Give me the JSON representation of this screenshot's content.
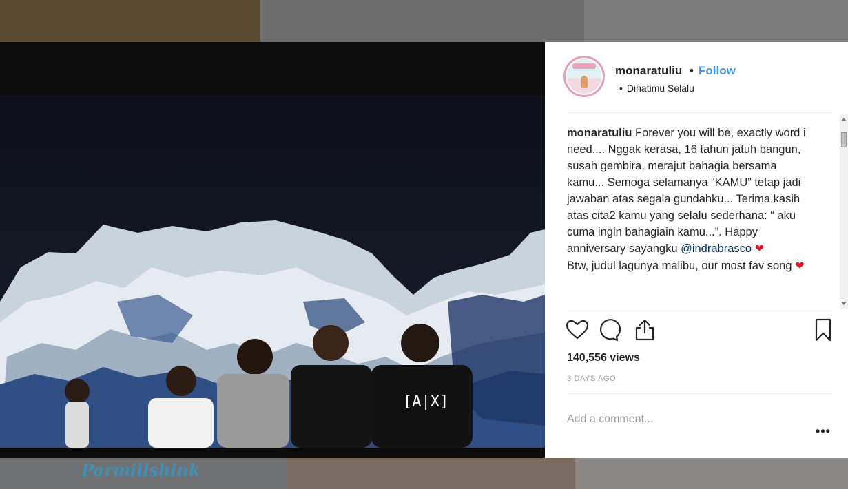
{
  "background": {
    "brand_text": "Parmillshink"
  },
  "post": {
    "username": "monaratuliu",
    "follow_label": "Follow",
    "separator": "•",
    "location": "Dihatimu Selalu",
    "caption": {
      "user": "monaratuliu",
      "text_1": " Forever you will be, exactly word i need.... Nggak kerasa, 16 tahun jatuh bangun, susah gembira, merajut bahagia bersama kamu... Semoga selamanya “KAMU” tetap jadi jawaban atas segala gundahku... Terima kasih atas cita2 kamu yang selalu sederhana: “ aku cuma ingin bahagiain kamu...”. Happy anniversary sayangku ",
      "mention": "@indrabrasco",
      "text_2": "Btw, judul lagunya malibu, our most fav song ",
      "heart": "❤"
    },
    "views": "140,556 views",
    "time_ago": "3 DAYS AGO",
    "comment_placeholder": "Add a comment...",
    "more_label": "•••",
    "video_shirt_text": "[A|X]"
  },
  "icons": {
    "like": "heart-icon",
    "comment": "comment-icon",
    "share": "share-icon",
    "save": "bookmark-icon",
    "more": "more-icon"
  },
  "colors": {
    "link": "#3897f0",
    "mention": "#003569",
    "heart": "#d9182d",
    "text": "#262626",
    "muted": "#999999"
  }
}
